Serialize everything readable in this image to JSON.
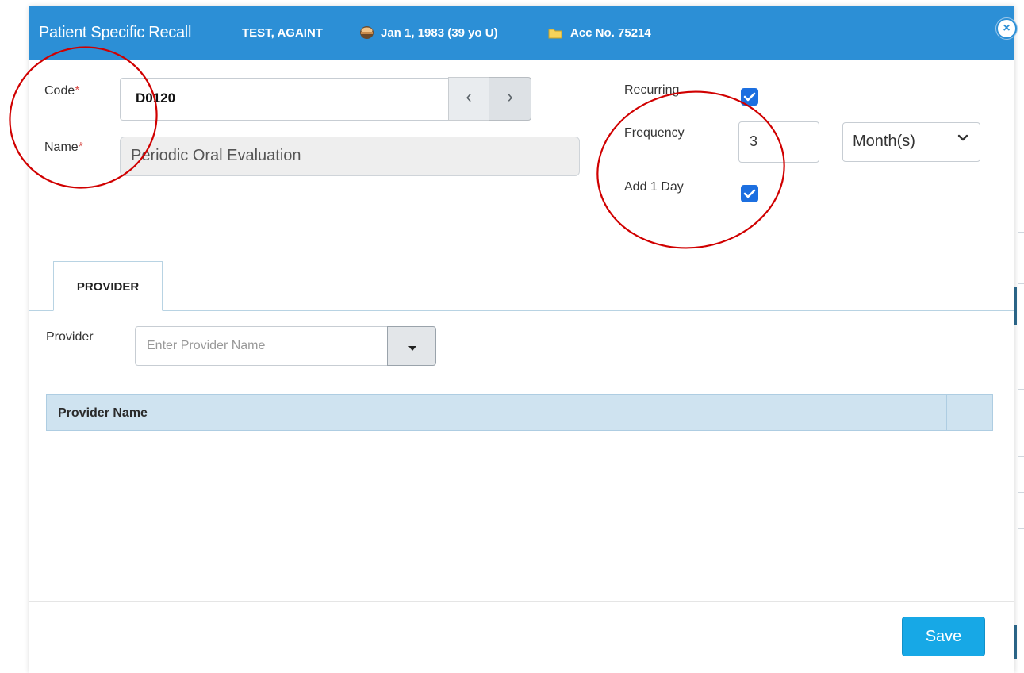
{
  "header": {
    "title": "Patient Specific Recall",
    "patient_name": "TEST, AGAINT",
    "dob": "Jan 1, 1983 (39 yo U)",
    "account": "Acc No. 75214",
    "close_glyph": "×",
    "icons": {
      "dob": "cake-icon",
      "account": "folder-icon",
      "close": "close-icon"
    },
    "color": "#2c8fd6"
  },
  "form": {
    "code": {
      "label": "Code",
      "required_mark": "*",
      "value": "D0120"
    },
    "name": {
      "label": "Name",
      "required_mark": "*",
      "value": "Periodic Oral Evaluation"
    },
    "nav": {
      "prev_glyph": "‹",
      "next_glyph": "›"
    },
    "recurring": {
      "label": "Recurring",
      "checked": true
    },
    "frequency": {
      "label": "Frequency",
      "value": "3",
      "unit": "Month(s)"
    },
    "add_one_day": {
      "label": "Add 1 Day",
      "checked": true
    }
  },
  "tabs": [
    {
      "label": "PROVIDER",
      "active": true
    }
  ],
  "provider": {
    "label": "Provider",
    "placeholder": "Enter Provider Name",
    "grid": {
      "columns": [
        "Provider Name",
        ""
      ],
      "rows": []
    }
  },
  "footer": {
    "save_label": "Save",
    "save_color": "#17a8e6"
  },
  "accent": {
    "checkbox": "#1c6fe0",
    "annotation": "#d00000"
  }
}
